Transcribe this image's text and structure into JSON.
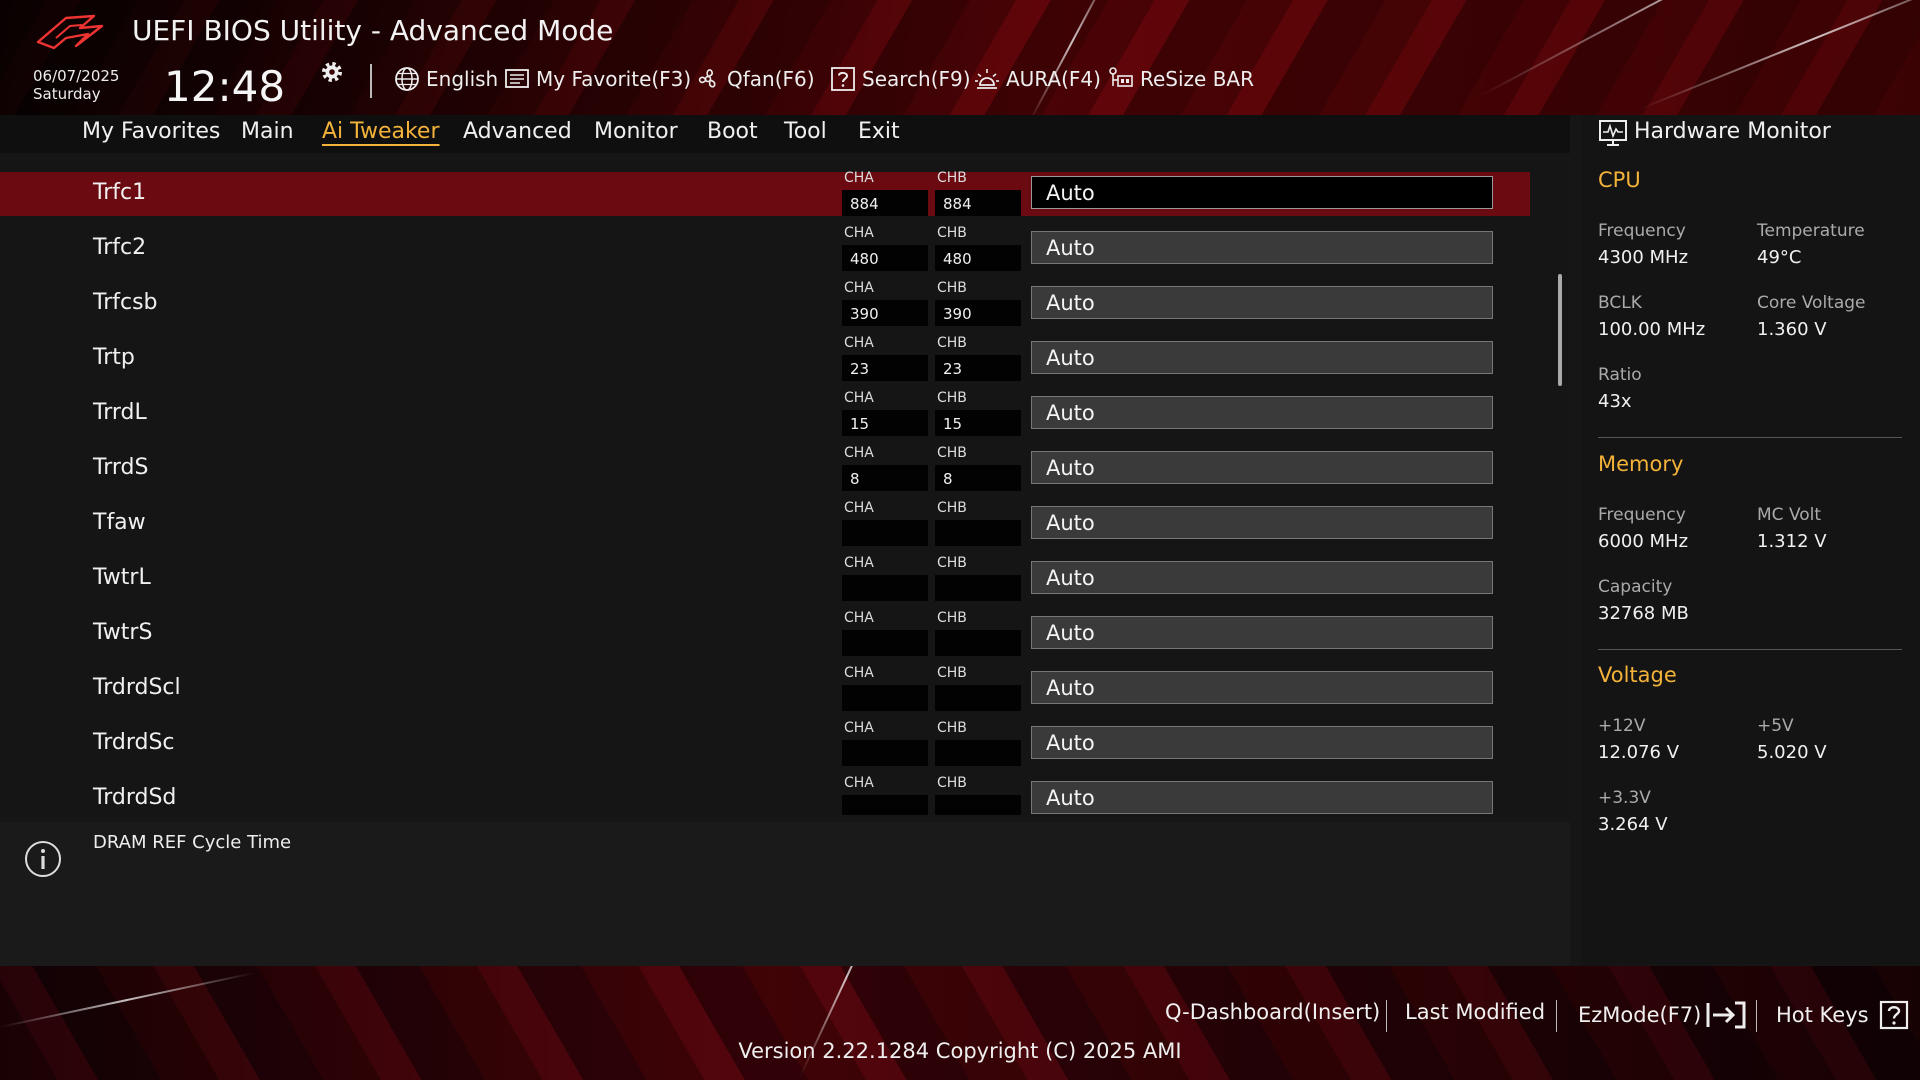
{
  "header": {
    "title": "UEFI BIOS Utility - Advanced Mode",
    "date": "06/07/2025",
    "day": "Saturday",
    "time": "12:48",
    "tools": [
      {
        "label": "English",
        "icon": "globe-icon"
      },
      {
        "label": "My Favorite(F3)",
        "icon": "favorite-list-icon"
      },
      {
        "label": "Qfan(F6)",
        "icon": "fan-icon"
      },
      {
        "label": "Search(F9)",
        "icon": "search-help-icon"
      },
      {
        "label": "AURA(F4)",
        "icon": "aura-light-icon"
      },
      {
        "label": "ReSize BAR",
        "icon": "resize-bar-icon"
      }
    ]
  },
  "menu": {
    "items": [
      "My Favorites",
      "Main",
      "Ai Tweaker",
      "Advanced",
      "Monitor",
      "Boot",
      "Tool",
      "Exit"
    ],
    "active": "Ai Tweaker"
  },
  "settings": {
    "channel_a": "CHA",
    "channel_b": "CHB",
    "rows": [
      {
        "label": "Trfc1",
        "cha": "884",
        "chb": "884",
        "value": "Auto"
      },
      {
        "label": "Trfc2",
        "cha": "480",
        "chb": "480",
        "value": "Auto"
      },
      {
        "label": "Trfcsb",
        "cha": "390",
        "chb": "390",
        "value": "Auto"
      },
      {
        "label": "Trtp",
        "cha": "23",
        "chb": "23",
        "value": "Auto"
      },
      {
        "label": "TrrdL",
        "cha": "15",
        "chb": "15",
        "value": "Auto"
      },
      {
        "label": "TrrdS",
        "cha": "8",
        "chb": "8",
        "value": "Auto"
      },
      {
        "label": "Tfaw",
        "cha": "",
        "chb": "",
        "value": "Auto"
      },
      {
        "label": "TwtrL",
        "cha": "",
        "chb": "",
        "value": "Auto"
      },
      {
        "label": "TwtrS",
        "cha": "",
        "chb": "",
        "value": "Auto"
      },
      {
        "label": "TrdrdScl",
        "cha": "",
        "chb": "",
        "value": "Auto"
      },
      {
        "label": "TrdrdSc",
        "cha": "",
        "chb": "",
        "value": "Auto"
      },
      {
        "label": "TrdrdSd",
        "cha": "",
        "chb": "",
        "value": "Auto"
      }
    ]
  },
  "info": {
    "text": "DRAM REF Cycle Time"
  },
  "hardware_monitor": {
    "title": "Hardware Monitor",
    "cpu": {
      "heading": "CPU",
      "frequency_label": "Frequency",
      "frequency": "4300 MHz",
      "temperature_label": "Temperature",
      "temperature": "49°C",
      "bclk_label": "BCLK",
      "bclk": "100.00 MHz",
      "core_voltage_label": "Core Voltage",
      "core_voltage": "1.360 V",
      "ratio_label": "Ratio",
      "ratio": "43x"
    },
    "memory": {
      "heading": "Memory",
      "frequency_label": "Frequency",
      "frequency": "6000 MHz",
      "mc_volt_label": "MC Volt",
      "mc_volt": "1.312 V",
      "capacity_label": "Capacity",
      "capacity": "32768 MB"
    },
    "voltage": {
      "heading": "Voltage",
      "v12_label": "+12V",
      "v12": "12.076 V",
      "v5_label": "+5V",
      "v5": "5.020 V",
      "v33_label": "+3.3V",
      "v33": "3.264 V"
    }
  },
  "footer": {
    "q_dashboard": "Q-Dashboard(Insert)",
    "last_modified": "Last Modified",
    "ezmode": "EzMode(F7)",
    "hotkeys": "Hot Keys",
    "version": "Version 2.22.1284 Copyright (C) 2025 AMI"
  },
  "colors": {
    "accent": "#f3b23a",
    "selected_row": "#6b0a10",
    "brand_red": "#8a0a12"
  }
}
